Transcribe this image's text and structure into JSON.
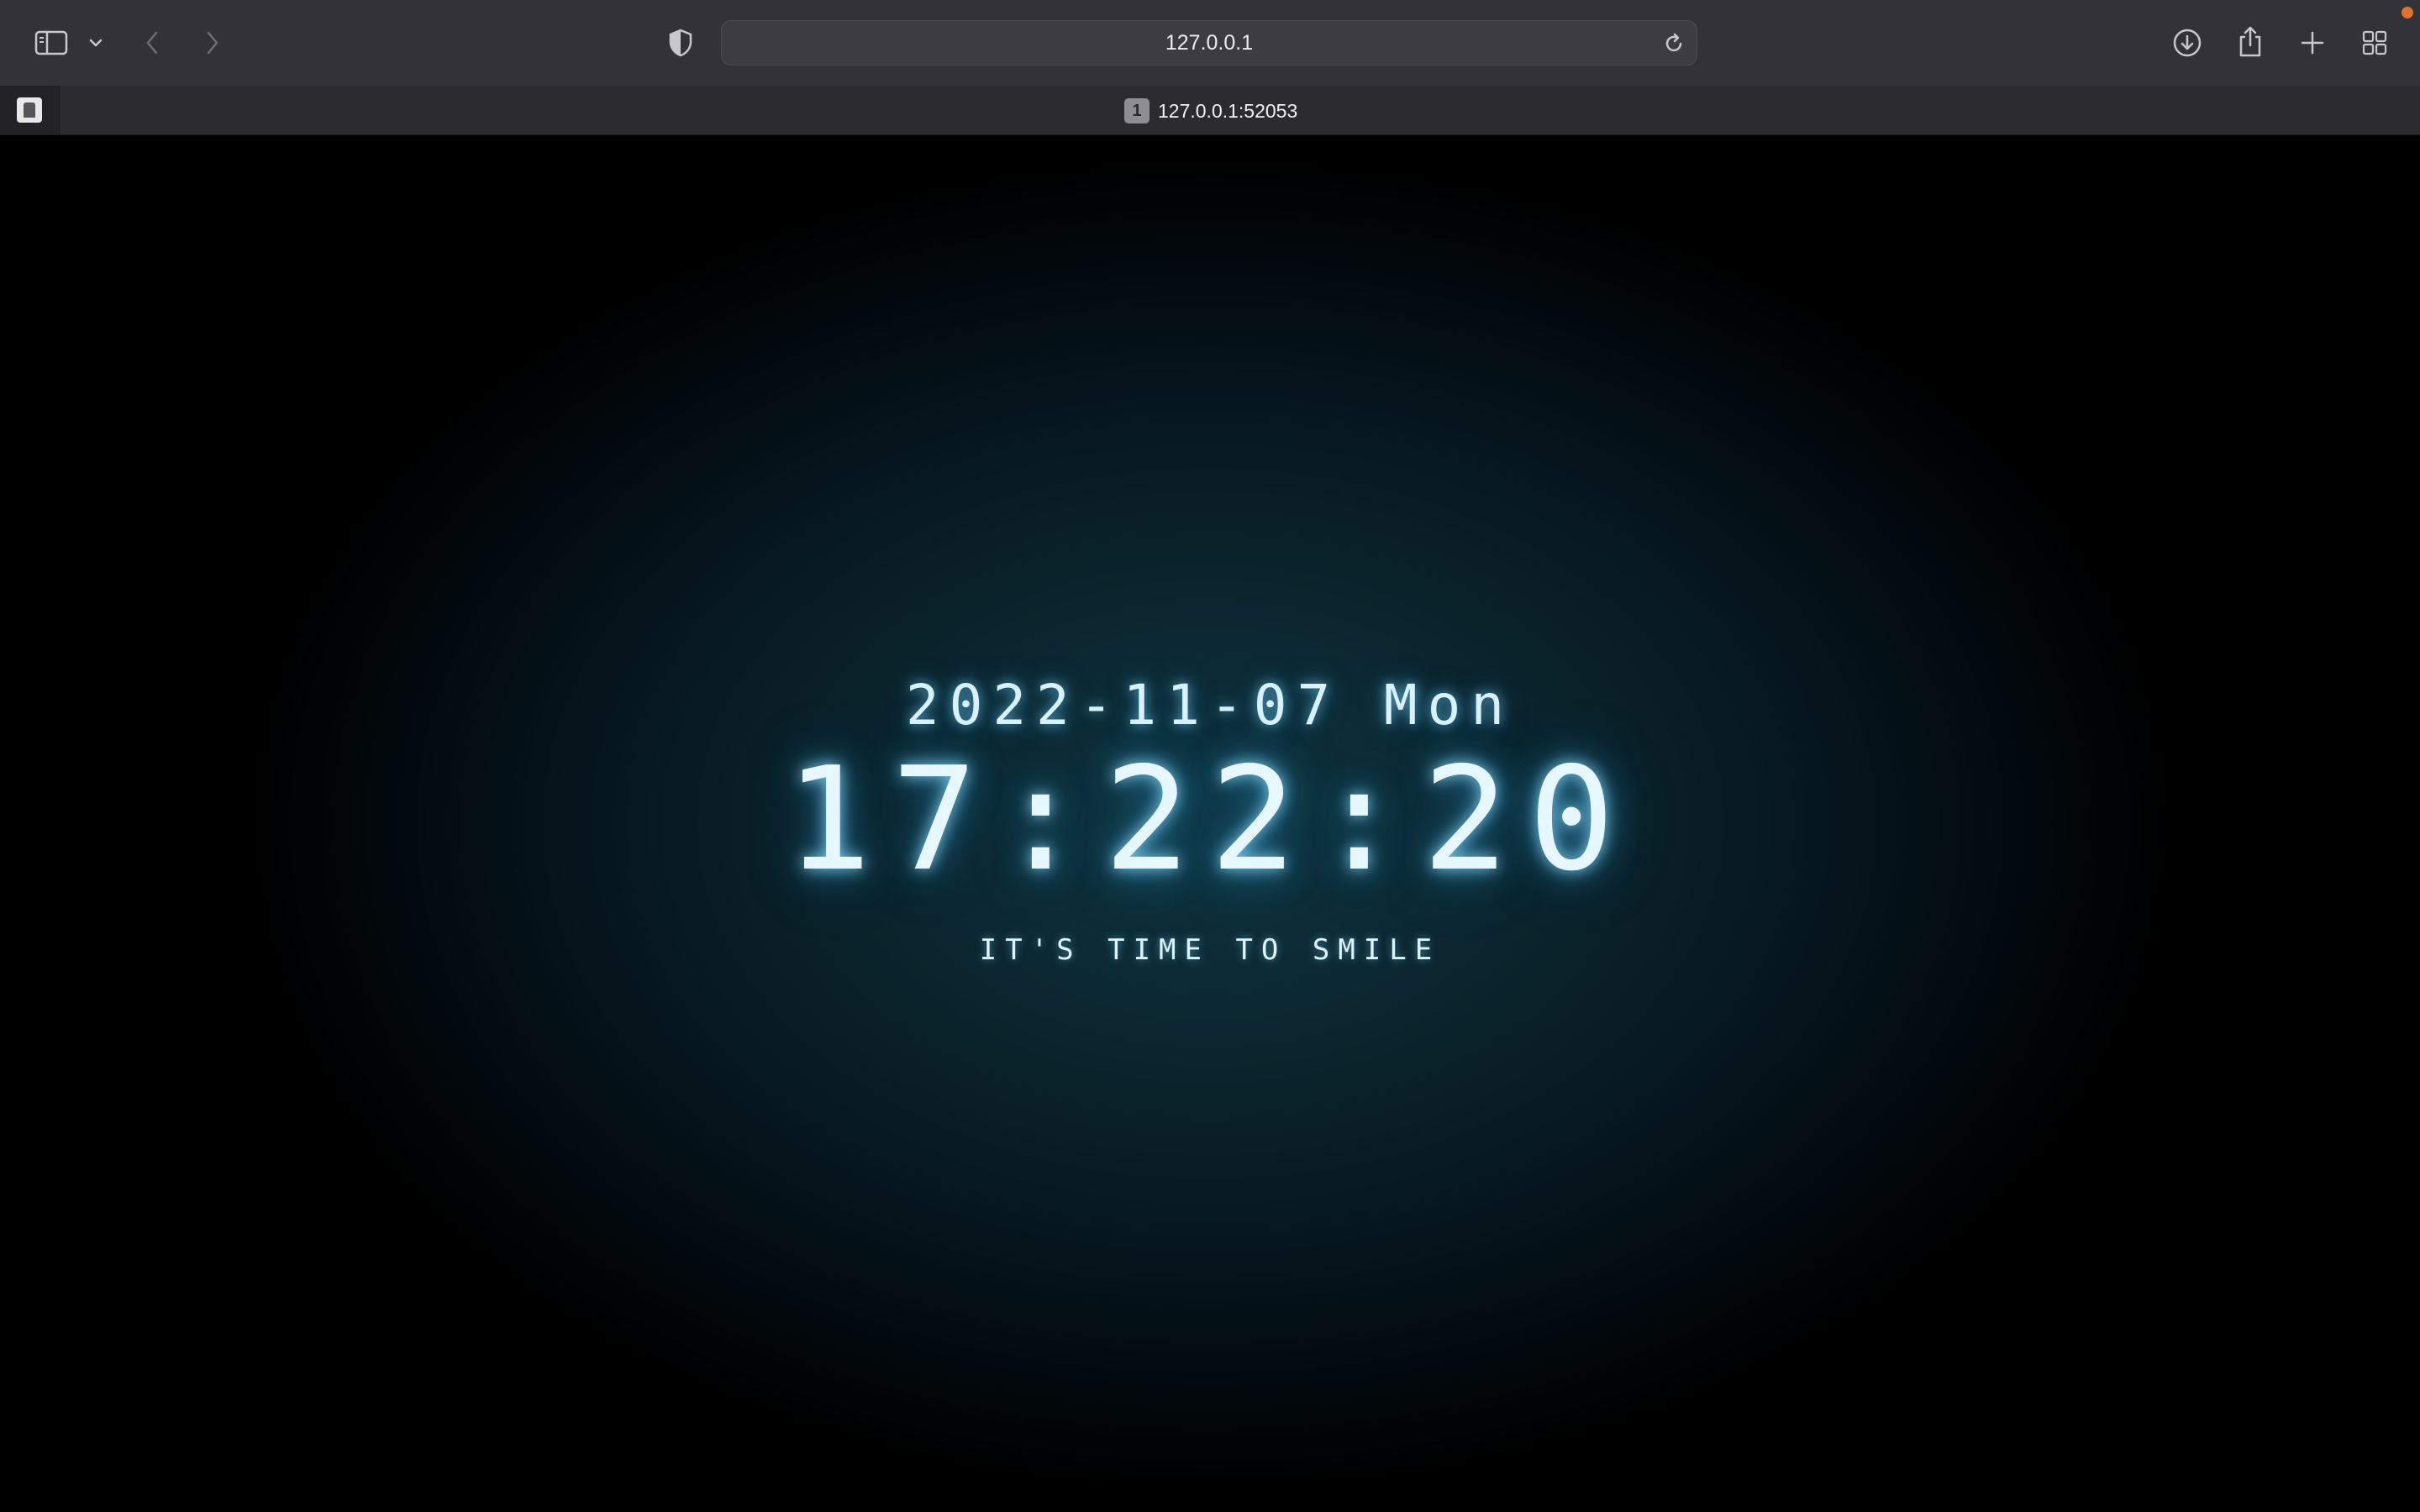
{
  "browser": {
    "address_bar_text": "127.0.0.1",
    "tab": {
      "badge": "1",
      "title": "127.0.0.1:52053"
    },
    "icons": {
      "sidebar": "sidebar-icon",
      "sidebar_menu": "chevron-down-icon",
      "back": "chevron-left-icon",
      "forward": "chevron-right-icon",
      "privacy": "shield-icon",
      "reload": "reload-icon",
      "downloads": "download-icon",
      "share": "share-icon",
      "new_tab": "plus-icon",
      "tab_overview": "grid-icon"
    },
    "colors": {
      "toolbar": "#333238",
      "tabbar": "#2c2b30",
      "notification": "#e0712e"
    }
  },
  "clock": {
    "date": "2022-11-07 Mon",
    "time": "17:22:20",
    "tagline": "IT'S TIME TO SMILE",
    "colors": {
      "glow": "#78d2ff",
      "text": "#e6f7ff",
      "background_center": "#0f3541"
    }
  }
}
